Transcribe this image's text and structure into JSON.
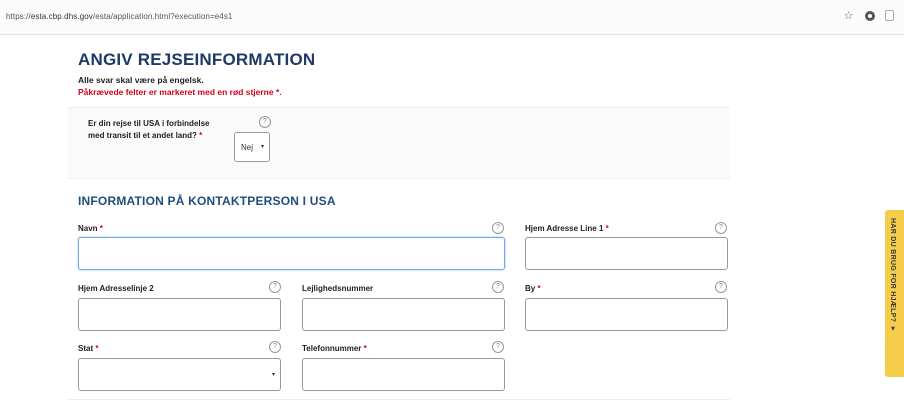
{
  "browser": {
    "url_prefix": "https://",
    "url_host": "esta.cbp.dhs.gov",
    "url_path": "/esta/application.html?execution=e4s1"
  },
  "page": {
    "title": "ANGIV REJSEINFORMATION",
    "note_english": "Alle svar skal være på engelsk.",
    "note_required": "Påkrævede felter er markeret med en rød stjerne *."
  },
  "transit": {
    "question": "Er din rejse til USA i forbindelse med transit til et andet land?",
    "required_mark": "*",
    "selected": "Nej",
    "caret": "▾"
  },
  "contact": {
    "heading": "INFORMATION PÅ KONTAKTPERSON I USA",
    "fields": {
      "name": {
        "label": "Navn",
        "required": "*",
        "value": ""
      },
      "address1": {
        "label": "Hjem Adresse Line 1",
        "required": "*",
        "value": ""
      },
      "address2": {
        "label": "Hjem Adresselinje 2",
        "value": ""
      },
      "apartment": {
        "label": "Lejlighedsnummer",
        "value": ""
      },
      "city": {
        "label": "By",
        "required": "*",
        "value": ""
      },
      "state": {
        "label": "Stat",
        "required": "*",
        "value": "",
        "caret": "▾"
      },
      "phone": {
        "label": "Telefonnummer",
        "required": "*",
        "value": ""
      }
    }
  },
  "help_glyph": "?",
  "help_tab": "HAR DU BRUG FOR HJÆLP? ▾",
  "icons": {
    "star": "star-icon",
    "opera": "opera-icon",
    "extension": "extension-icon"
  }
}
